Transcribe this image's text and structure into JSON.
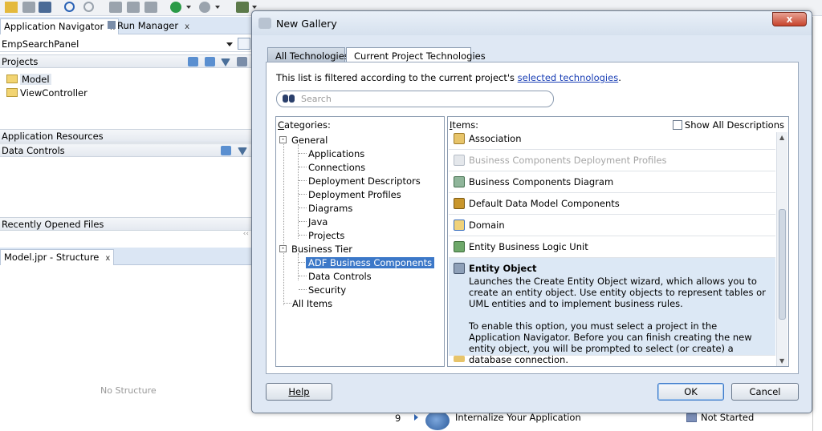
{
  "ide": {
    "nav_tab_label": "Application Navigator",
    "nav_tab_close": "x",
    "run_tab_label": "Run Manager",
    "run_tab_close": "x",
    "project_select_value": "EmpSearchPanel",
    "projects_header": "Projects",
    "project_items": [
      "Model",
      "ViewController"
    ],
    "app_resources_header": "Application Resources",
    "data_controls_header": "Data Controls",
    "recent_files_header": "Recently Opened Files",
    "structure_tab_label": "Model.jpr - Structure",
    "structure_tab_close": "x",
    "no_structure_text": "No Structure",
    "bottom_row": {
      "number": "9",
      "task": "Internalize Your Application",
      "status": "Not Started"
    }
  },
  "dialog": {
    "title": "New Gallery",
    "close_label": "x",
    "tabs": [
      "All Technologies",
      "Current Project Technologies"
    ],
    "active_tab": "All Technologies",
    "filter_text_prefix": "This list is filtered according to the current project's",
    "filter_link": "selected technologies",
    "filter_text_suffix": ".",
    "search_placeholder": "Search",
    "categories_label": "Categories:",
    "categories": {
      "general": "General",
      "general_children": [
        "Applications",
        "Connections",
        "Deployment Descriptors",
        "Deployment Profiles",
        "Diagrams",
        "Java",
        "Projects"
      ],
      "business_tier": "Business Tier",
      "business_children": [
        "ADF Business Components",
        "Data Controls",
        "Security"
      ],
      "selected": "ADF Business Components",
      "all_items": "All Items"
    },
    "items_label": "Items:",
    "show_all_label": "Show All Descriptions",
    "items": [
      {
        "name": "Association",
        "icon": "association-icon"
      },
      {
        "name": "Business Components Deployment Profiles",
        "icon": "deployment-profile-icon",
        "disabled": true
      },
      {
        "name": "Business Components Diagram",
        "icon": "diagram-icon"
      },
      {
        "name": "Default Data Model Components",
        "icon": "data-model-icon"
      },
      {
        "name": "Domain",
        "icon": "domain-icon"
      },
      {
        "name": "Entity Business Logic Unit",
        "icon": "logic-unit-icon"
      }
    ],
    "selected_item": {
      "name": "Entity Object",
      "icon": "entity-object-icon",
      "desc1": "Launches the Create Entity Object wizard, which allows you to create an entity object.  Use entity objects to represent tables or UML entities and to implement business rules.",
      "desc2": "To enable this option, you must select a project in the Application Navigator. Before you can finish creating the new entity object, you will be prompted to select (or create) a database connection."
    },
    "buttons": {
      "help": "Help",
      "ok": "OK",
      "cancel": "Cancel"
    }
  }
}
